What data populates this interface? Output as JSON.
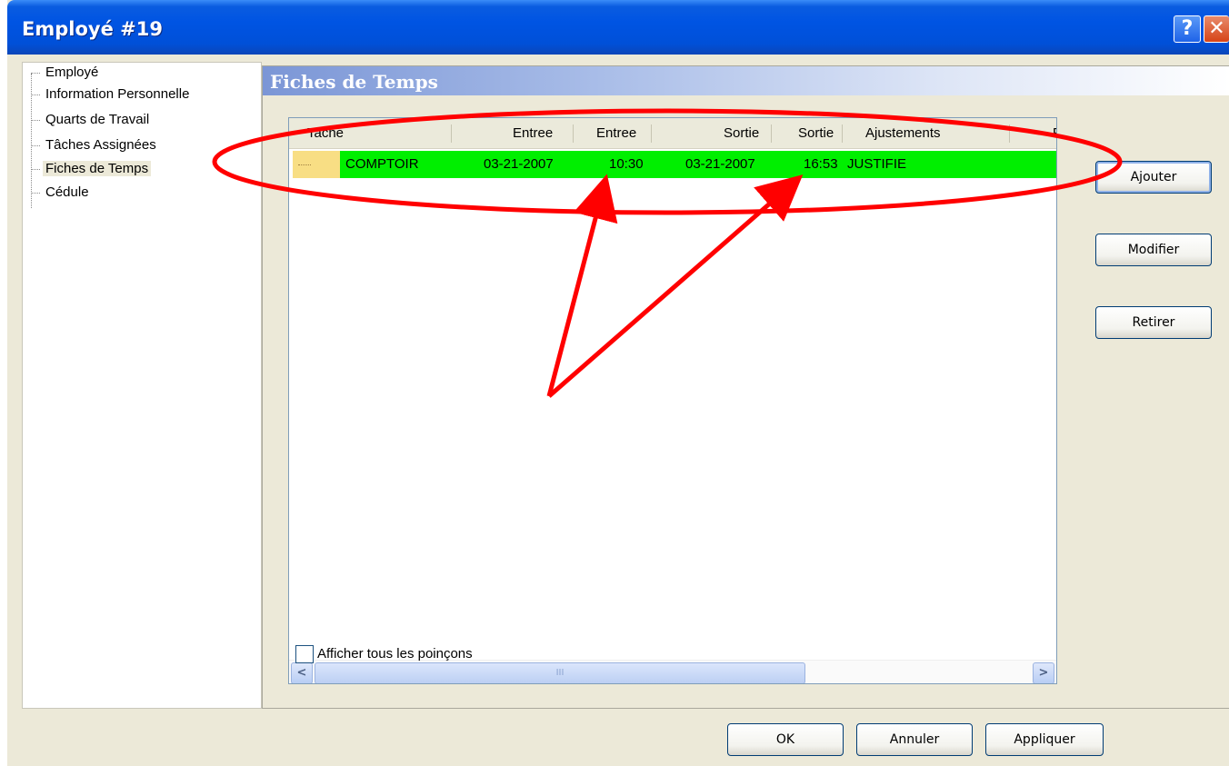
{
  "window": {
    "title": "Employé #19",
    "help_icon": "help-icon",
    "close_icon": "close-icon"
  },
  "sidebar": {
    "items": [
      {
        "label": "Employé",
        "selected": false
      },
      {
        "label": "Information Personnelle",
        "selected": false
      },
      {
        "label": "Quarts de Travail",
        "selected": false
      },
      {
        "label": "Tâches Assignées",
        "selected": false
      },
      {
        "label": "Fiches de Temps",
        "selected": true
      },
      {
        "label": "Cédule",
        "selected": false
      }
    ]
  },
  "section": {
    "title": "Fiches de Temps"
  },
  "table": {
    "columns": [
      "Tache",
      "Entree",
      "Entree",
      "Sortie",
      "Sortie",
      "Ajustements",
      "P"
    ],
    "rows": [
      {
        "tache": "COMPTOIR",
        "entree_date": "03-21-2007",
        "entree_time": "10:30",
        "sortie_date": "03-21-2007",
        "sortie_time": "16:53",
        "ajustements": "JUSTIFIE",
        "row_color": "#00ef00"
      }
    ]
  },
  "scrollbar": {
    "left_icon": "chevron-left-icon",
    "right_icon": "chevron-right-icon",
    "thumb_grip": "III"
  },
  "side_buttons": {
    "add": "Ajouter",
    "modify": "Modifier",
    "remove": "Retirer"
  },
  "checkbox": {
    "label": "Afficher tous les poinçons",
    "checked": false
  },
  "footer_buttons": {
    "ok": "OK",
    "cancel": "Annuler",
    "apply": "Appliquer"
  },
  "annotation": {
    "color": "#ff0000"
  }
}
